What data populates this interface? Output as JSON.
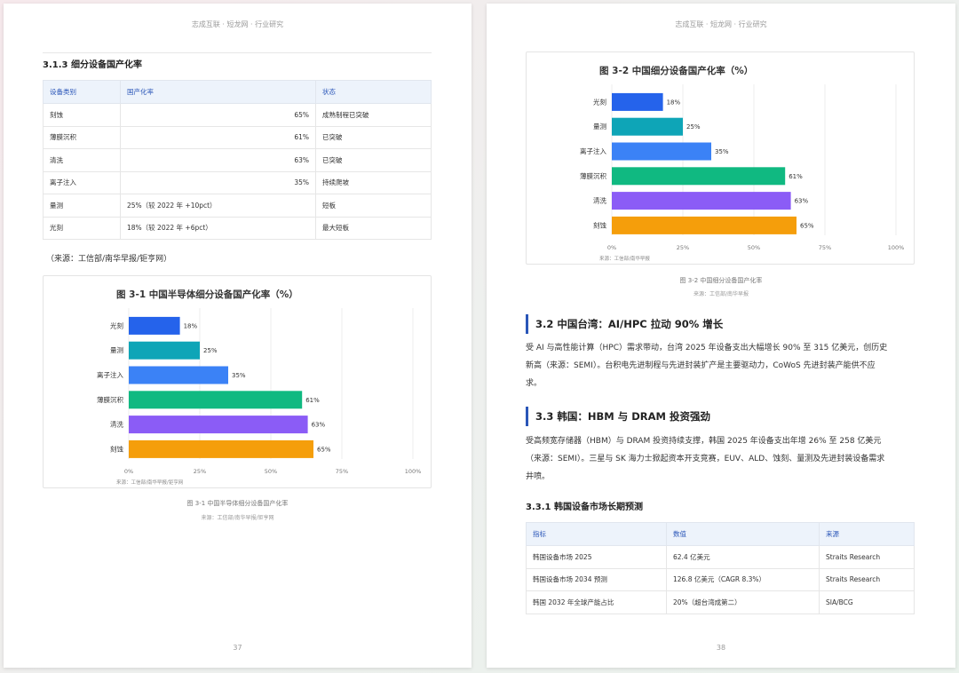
{
  "left_page": {
    "running_head": "志成互联 · 短龙网 · 行业研究",
    "section_heading": "3.1.3 细分设备国产化率",
    "table": {
      "headers": [
        "设备类别",
        "国产化率",
        "状态"
      ],
      "rows": [
        {
          "category": "刻蚀",
          "rate": "65%",
          "status": "成熟制程已突破"
        },
        {
          "category": "薄膜沉积",
          "rate": "61%",
          "status": "已突破"
        },
        {
          "category": "清洗",
          "rate": "63%",
          "status": "已突破"
        },
        {
          "category": "离子注入",
          "rate": "35%",
          "status": "持续爬坡"
        },
        {
          "category": "量测",
          "rate": "25%（较 2022 年 +10pct）",
          "status": "短板"
        },
        {
          "category": "光刻",
          "rate": "18%（较 2022 年 +6pct）",
          "status": "最大短板"
        }
      ]
    },
    "source_note": "（来源：工信部/南华早报/钜亨网）",
    "figure_caption": "图 3-1 中国半导体细分设备国产化率",
    "figure_source": "来源：工信部/南华早报/钜亨网",
    "page_number": "37"
  },
  "right_page": {
    "running_head": "志成互联 · 短龙网 · 行业研究",
    "figure_caption": "图 3-2 中国细分设备国产化率",
    "figure_source": "来源：工信部/南华早报",
    "section_32": {
      "heading": "3.2 中国台湾：AI/HPC 拉动 90% 增长",
      "lines": [
        "受 AI 与高性能计算（HPC）需求带动，台湾 2025 年设备支出大幅增长 90% 至 315 亿美元，创历史",
        "新高（来源：SEMI）。台积电先进制程与先进封装扩产是主要驱动力，CoWoS 先进封装产能供不应",
        "求。"
      ]
    },
    "section_33": {
      "heading": "3.3 韩国：HBM 与 DRAM 投资强劲",
      "lines": [
        "受高频宽存储器（HBM）与 DRAM 投资持续支撑，韩国 2025 年设备支出年增 26% 至 258 亿美元",
        "（来源：SEMI）。三星与 SK 海力士掀起资本开支竞赛，EUV、ALD、蚀刻、量测及先进封装设备需求",
        "井喷。"
      ]
    },
    "subsection_heading": "3.3.1 韩国设备市场长期预测",
    "table": {
      "headers": [
        "指标",
        "数值",
        "来源"
      ],
      "rows": [
        {
          "metric": "韩国设备市场 2025",
          "value": "62.4 亿美元",
          "source": "Straits Research"
        },
        {
          "metric": "韩国设备市场 2034 预测",
          "value": "126.8 亿美元（CAGR 8.3%）",
          "source": "Straits Research"
        },
        {
          "metric": "韩国 2032 年全球产能占比",
          "value": "20%（超台湾成第二）",
          "source": "SIA/BCG"
        }
      ]
    },
    "page_number": "38"
  },
  "chart_data": [
    {
      "type": "bar",
      "orientation": "horizontal",
      "title": "图 3-1 中国半导体细分设备国产化率（%）",
      "categories": [
        "光刻",
        "量测",
        "离子注入",
        "薄膜沉积",
        "清洗",
        "刻蚀"
      ],
      "values": [
        18,
        25,
        35,
        61,
        63,
        65
      ],
      "value_labels": [
        "18%",
        "25%",
        "35%",
        "61%",
        "63%",
        "65%"
      ],
      "colors": [
        "#2563eb",
        "#0ea5b7",
        "#3b82f6",
        "#10b981",
        "#8b5cf6",
        "#f59e0b"
      ],
      "xlim": [
        0,
        100
      ],
      "x_ticks": [
        "0%",
        "25%",
        "50%",
        "75%",
        "100%"
      ],
      "grid": true,
      "source": "来源：工信部/南华早报/钜亨网"
    },
    {
      "type": "bar",
      "orientation": "horizontal",
      "title": "图 3-2 中国细分设备国产化率（%）",
      "categories": [
        "光刻",
        "量测",
        "离子注入",
        "薄膜沉积",
        "清洗",
        "刻蚀"
      ],
      "values": [
        18,
        25,
        35,
        61,
        63,
        65
      ],
      "value_labels": [
        "18%",
        "25%",
        "35%",
        "61%",
        "63%",
        "65%"
      ],
      "colors": [
        "#2563eb",
        "#0ea5b7",
        "#3b82f6",
        "#10b981",
        "#8b5cf6",
        "#f59e0b"
      ],
      "xlim": [
        0,
        100
      ],
      "x_ticks": [
        "0%",
        "25%",
        "50%",
        "75%",
        "100%"
      ],
      "grid": true,
      "source": "来源：工信部/南华早报"
    }
  ]
}
